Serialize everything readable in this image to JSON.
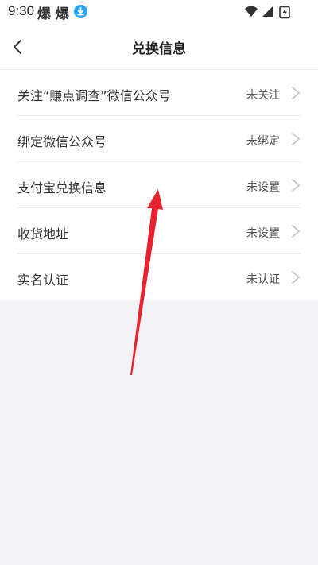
{
  "status_bar": {
    "time": "9:30",
    "app_icon_1": "爆",
    "app_icon_2": "爆",
    "download_icon": "download-icon",
    "right_icons": [
      "wifi-icon",
      "signal-icon",
      "battery-icon"
    ]
  },
  "header": {
    "back_icon": "chevron-left-icon",
    "title": "兑换信息"
  },
  "list": {
    "items": [
      {
        "label": "关注“赚点调查”微信公众号",
        "value": "未关注"
      },
      {
        "label": "绑定微信公众号",
        "value": "未绑定"
      },
      {
        "label": "支付宝兑换信息",
        "value": "未设置"
      },
      {
        "label": "收货地址",
        "value": "未设置"
      },
      {
        "label": "实名认证",
        "value": "未认证"
      }
    ],
    "chevron_icon": "chevron-right-icon"
  },
  "colors": {
    "background": "#f2f2f7",
    "surface": "#ffffff",
    "text_primary": "#333333",
    "text_secondary": "#555555",
    "chevron": "#c4c4c4",
    "download_badge": "#2aa3f5",
    "annotation_arrow": "#e8232f"
  }
}
